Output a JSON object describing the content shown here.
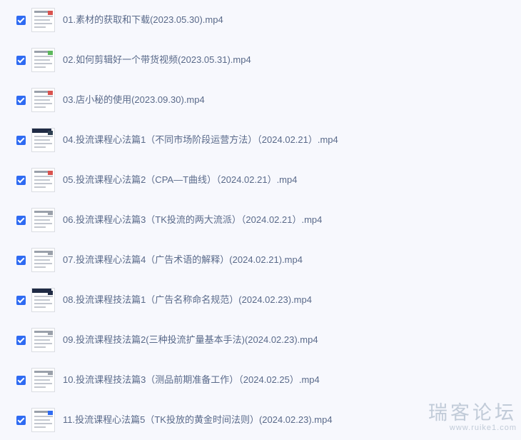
{
  "files": [
    {
      "name": "01.素材的获取和下载(2023.05.30).mp4",
      "checked": true,
      "thumb_accent": "#d9534f"
    },
    {
      "name": "02.如何剪辑好一个带货视频(2023.05.31).mp4",
      "checked": true,
      "thumb_accent": "#5cb85c"
    },
    {
      "name": "03.店小秘的使用(2023.09.30).mp4",
      "checked": true,
      "thumb_accent": "#d9534f"
    },
    {
      "name": "04.投流课程心法篇1（不同市场阶段运营方法）（2024.02.21）.mp4",
      "checked": true,
      "thumb_accent": "#2c3e50"
    },
    {
      "name": "05.投流课程心法篇2（CPA—T曲线）（2024.02.21）.mp4",
      "checked": true,
      "thumb_accent": "#d9534f"
    },
    {
      "name": "06.投流课程心法篇3（TK投流的两大流派）（2024.02.21）.mp4",
      "checked": true,
      "thumb_accent": "#9aa0aa"
    },
    {
      "name": "07.投流课程心法篇4（广告术语的解释）(2024.02.21).mp4",
      "checked": true,
      "thumb_accent": "#9aa0aa"
    },
    {
      "name": "08.投流课程技法篇1（广告名称命名规范）(2024.02.23).mp4",
      "checked": true,
      "thumb_accent": "#1f2a44"
    },
    {
      "name": "09.投流课程技法篇2(三种投流扩量基本手法)(2024.02.23).mp4",
      "checked": true,
      "thumb_accent": "#9aa0aa"
    },
    {
      "name": "10.投流课程技法篇3（测品前期准备工作）（2024.02.25）.mp4",
      "checked": true,
      "thumb_accent": "#9aa0aa"
    },
    {
      "name": "11.投流课程心法篇5（TK投放的黄金时间法则）(2024.02.23).mp4",
      "checked": true,
      "thumb_accent": "#2f6bf2"
    }
  ],
  "watermark": {
    "text": "瑞客论坛",
    "url": "www.ruike1.com"
  },
  "colors": {
    "checkbox": "#2f6bf2",
    "text": "#5a6a8a",
    "background": "#f7f8fd"
  }
}
